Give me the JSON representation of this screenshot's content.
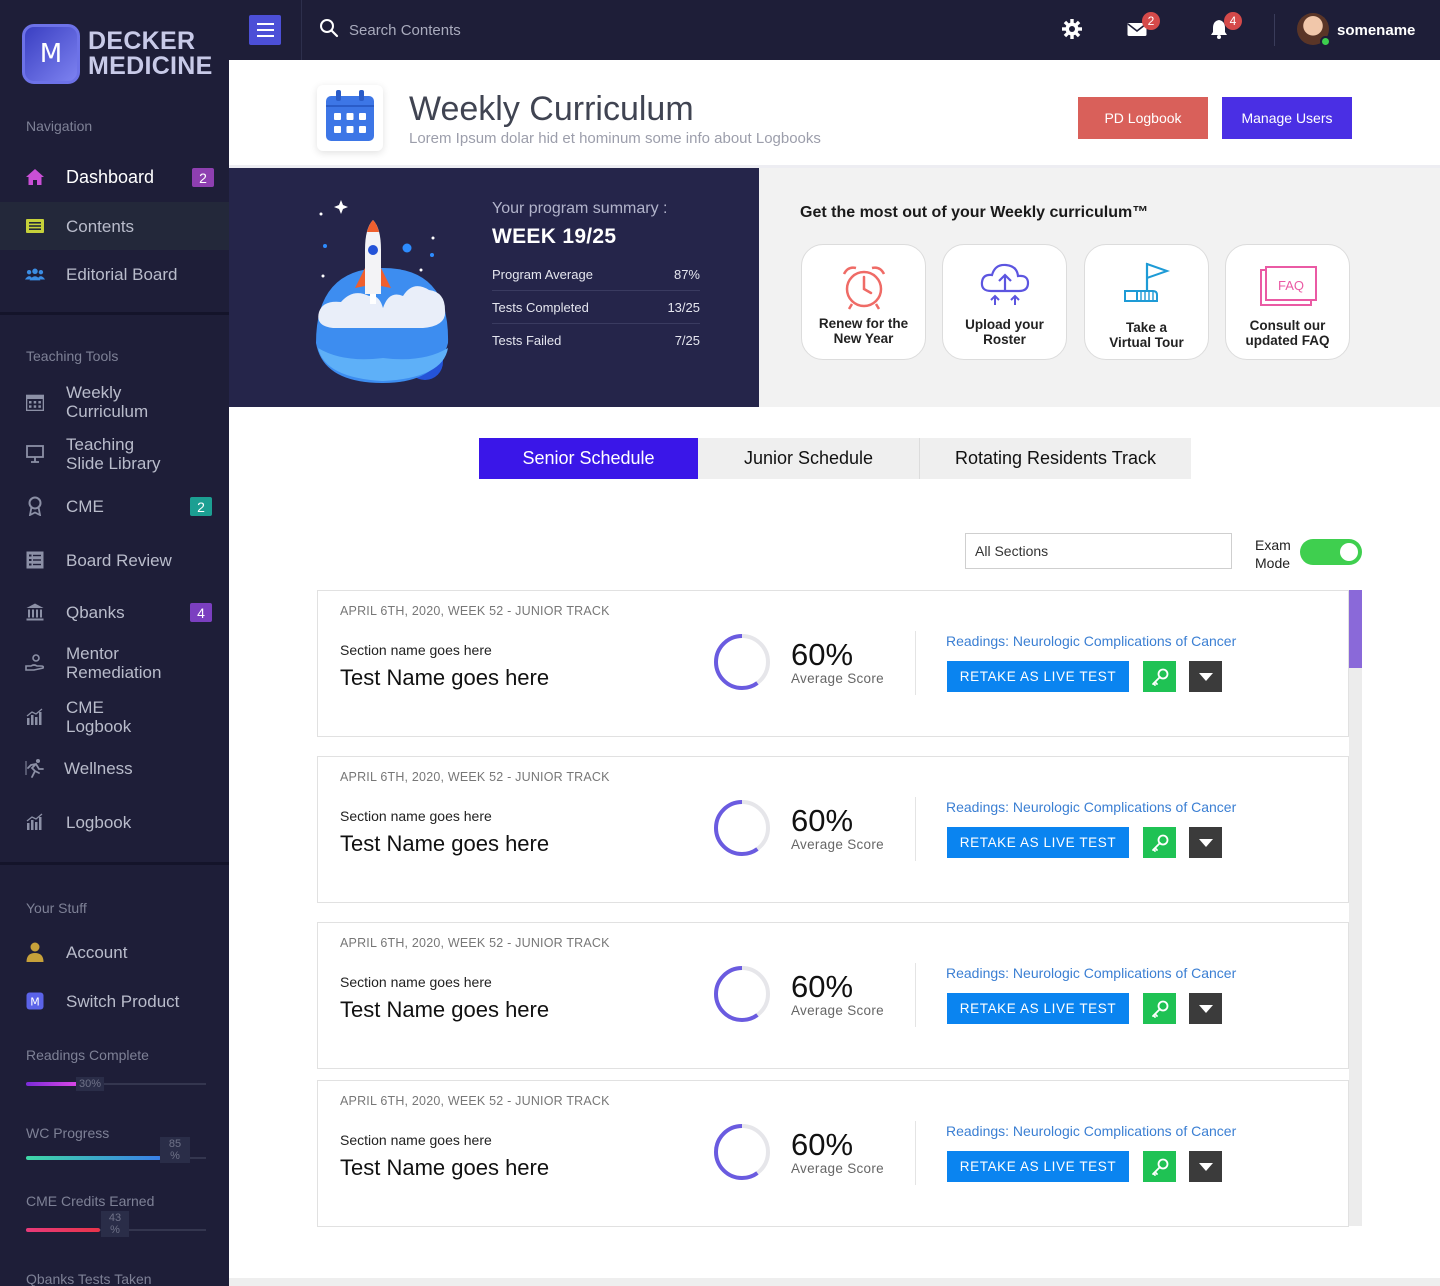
{
  "brand": {
    "logo_letter": "M",
    "line1": "DECKER",
    "line2": "MEDICINE"
  },
  "sidebar": {
    "nav_title": "Navigation",
    "nav_items": [
      {
        "label": "Dashboard",
        "icon": "home-icon",
        "badge": "2",
        "badge_color": "#8e3fb0"
      },
      {
        "label": "Contents",
        "icon": "list-icon"
      },
      {
        "label": "Editorial Board",
        "icon": "users-icon"
      }
    ],
    "tools_title": "Teaching Tools",
    "tools_items": [
      {
        "label": "Weekly Curriculum",
        "icon": "calendar-icon"
      },
      {
        "label": "Teaching Slide Library",
        "icon": "presentation-icon"
      },
      {
        "label": "CME",
        "icon": "award-icon",
        "badge": "2",
        "badge_color": "#1c9f92"
      },
      {
        "label": "Board Review",
        "icon": "checklist-icon"
      },
      {
        "label": "Qbanks",
        "icon": "bank-icon",
        "badge": "4",
        "badge_color": "#7b3fc0"
      },
      {
        "label": "Mentor Remediation",
        "icon": "hand-icon"
      },
      {
        "label": "CME Logbook",
        "icon": "bar-chart-icon"
      },
      {
        "label": "Wellness",
        "icon": "running-icon"
      },
      {
        "label": "Logbook",
        "icon": "bar-chart-icon"
      }
    ],
    "stuff_title": "Your Stuff",
    "stuff_items": [
      {
        "label": "Account",
        "icon": "user-icon"
      },
      {
        "label": "Switch Product",
        "icon": "switch-product-icon"
      }
    ],
    "meters": [
      {
        "label": "Readings Complete",
        "value_text": "30%",
        "fraction": 0.3,
        "color": "#b43de0"
      },
      {
        "label": "WC Progress",
        "value_text": "85 %",
        "fraction": 0.75,
        "color": "#3fa9e6"
      },
      {
        "label": "CME Credits Earned",
        "value_text": "43 %",
        "fraction": 0.41,
        "color": "#e2366d"
      },
      {
        "label": "Qbanks Tests Taken"
      }
    ]
  },
  "topbar": {
    "search_placeholder": "Search Contents",
    "messages_count": "2",
    "notifications_count": "4",
    "username": "somename"
  },
  "header": {
    "title": "Weekly Curriculum",
    "subtitle": "Lorem Ipsum dolar hid et hominum some info about Logbooks",
    "pd_logbook": "PD Logbook",
    "manage_users": "Manage Users"
  },
  "summary": {
    "title": "Your program summary :",
    "week": "WEEK 19/25",
    "rows": [
      {
        "label": "Program Average",
        "value": "87%"
      },
      {
        "label": "Tests Completed",
        "value": "13/25"
      },
      {
        "label": "Tests Failed",
        "value": "7/25"
      }
    ]
  },
  "tips": {
    "title": "Get the most out of your Weekly curriculum™",
    "cards": [
      {
        "line1": "Renew for the",
        "line2": "New Year",
        "icon": "alarm-clock-icon"
      },
      {
        "line1": "Upload your",
        "line2": "Roster",
        "icon": "cloud-upload-icon"
      },
      {
        "line1": "Take a",
        "line2": "Virtual Tour",
        "icon": "flag-tour-icon"
      },
      {
        "line1": "Consult our",
        "line2": "updated FAQ",
        "icon": "faq-icon",
        "faq_text": "FAQ"
      }
    ]
  },
  "tabs": [
    "Senior Schedule",
    "Junior Schedule",
    "Rotating Residents Track"
  ],
  "filters": {
    "section_select": "All Sections",
    "exam_mode_line1": "Exam",
    "exam_mode_line2": "Mode",
    "exam_mode_on": true
  },
  "tests": [
    {
      "meta": "APRIL 6TH, 2020,  WEEK 52 - JUNIOR TRACK",
      "section": "Section name goes here",
      "name": "Test Name goes here",
      "score": "60%",
      "score_fraction": 0.6,
      "score_label": "Average Score",
      "reading": "Readings: Neurologic Complications of Cancer",
      "retake": "RETAKE AS LIVE TEST"
    },
    {
      "meta": "APRIL 6TH, 2020,  WEEK 52 - JUNIOR TRACK",
      "section": "Section name goes here",
      "name": "Test Name goes here",
      "score": "60%",
      "score_fraction": 0.6,
      "score_label": "Average Score",
      "reading": "Readings: Neurologic Complications of Cancer",
      "retake": "RETAKE AS LIVE TEST"
    },
    {
      "meta": "APRIL 6TH, 2020,  WEEK 52 - JUNIOR TRACK",
      "section": "Section name goes here",
      "name": "Test Name goes here",
      "score": "60%",
      "score_fraction": 0.6,
      "score_label": "Average Score",
      "reading": "Readings: Neurologic Complications of Cancer",
      "retake": "RETAKE AS LIVE TEST"
    },
    {
      "meta": "APRIL 6TH, 2020,  WEEK 52 - JUNIOR TRACK",
      "section": "Section name goes here",
      "name": "Test Name goes here",
      "score": "60%",
      "score_fraction": 0.6,
      "score_label": "Average Score",
      "reading": "Readings: Neurologic Complications of Cancer",
      "retake": "RETAKE AS LIVE TEST"
    }
  ],
  "colors": {
    "accent": "#3a16e8",
    "sidebar_bg": "#1e1e38",
    "summary_bg": "#25254a",
    "retake": "#0a84f0",
    "key": "#1fc254",
    "toggle_on": "#3fcf4f"
  }
}
